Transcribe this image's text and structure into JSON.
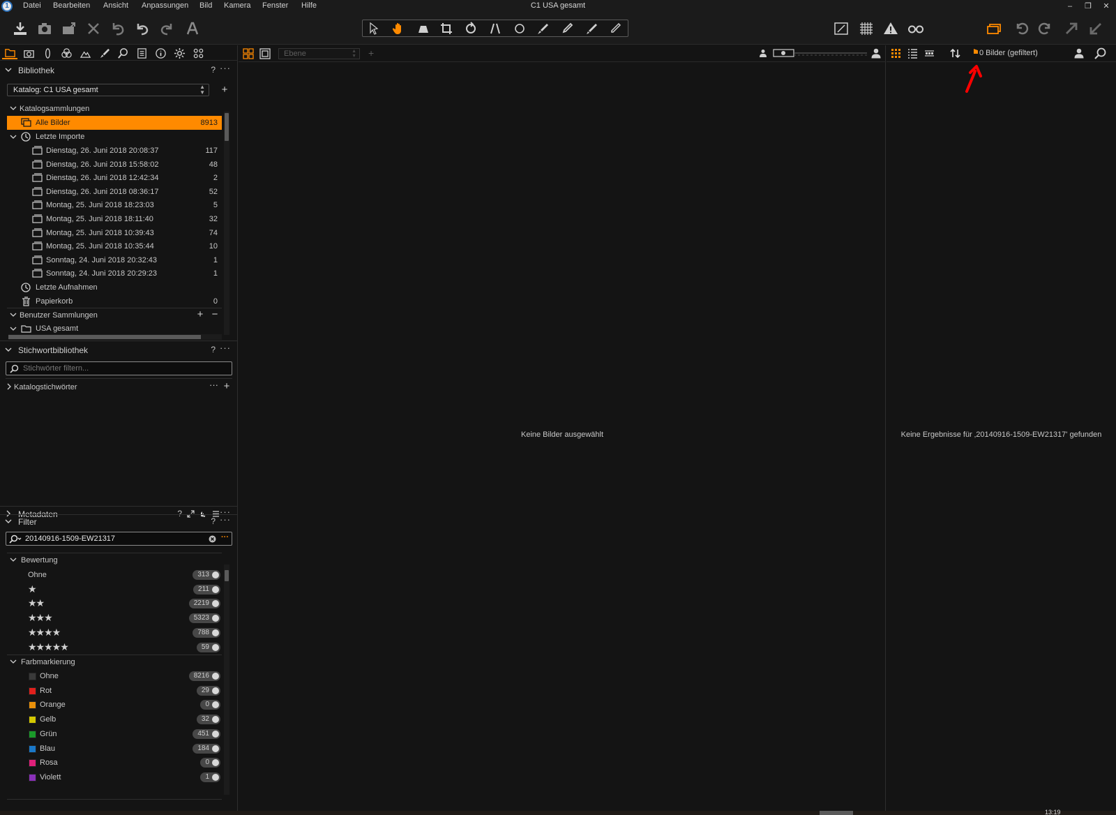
{
  "window": {
    "title": "C1 USA gesamt",
    "minimize": "–",
    "maximize": "❐",
    "close": "✕"
  },
  "menu": [
    "Datei",
    "Bearbeiten",
    "Ansicht",
    "Anpassungen",
    "Bild",
    "Kamera",
    "Fenster",
    "Hilfe"
  ],
  "colors": {
    "accent": "#ff8a00",
    "annotation_arrow": "#ff0000",
    "background": "#141414"
  },
  "library": {
    "title": "Bibliothek",
    "help": "?",
    "more": "···",
    "catalog_select": "Katalog: C1 USA gesamt",
    "catalog_collections": "Katalogsammlungen",
    "all_images": {
      "label": "Alle Bilder",
      "count": "8913"
    },
    "recent_imports": {
      "label": "Letzte Importe",
      "items": [
        {
          "label": "Dienstag, 26. Juni 2018 20:08:37",
          "count": "117"
        },
        {
          "label": "Dienstag, 26. Juni 2018 15:58:02",
          "count": "48"
        },
        {
          "label": "Dienstag, 26. Juni 2018 12:42:34",
          "count": "2"
        },
        {
          "label": "Dienstag, 26. Juni 2018 08:36:17",
          "count": "52"
        },
        {
          "label": "Montag, 25. Juni 2018 18:23:03",
          "count": "5"
        },
        {
          "label": "Montag, 25. Juni 2018 18:11:40",
          "count": "32"
        },
        {
          "label": "Montag, 25. Juni 2018 10:39:43",
          "count": "74"
        },
        {
          "label": "Montag, 25. Juni 2018 10:35:44",
          "count": "10"
        },
        {
          "label": "Sonntag, 24. Juni 2018 20:32:43",
          "count": "1"
        },
        {
          "label": "Sonntag, 24. Juni 2018 20:29:23",
          "count": "1"
        }
      ]
    },
    "recent_captures": "Letzte Aufnahmen",
    "trash": {
      "label": "Papierkorb",
      "count": "0"
    },
    "user_collections": "Benutzer Sammlungen",
    "usa_folder": "USA gesamt"
  },
  "keywords": {
    "title": "Stichwortbibliothek",
    "help": "?",
    "more": "···",
    "filter_placeholder": "Stichwörter filtern...",
    "catalog_keywords": "Katalogstichwörter"
  },
  "metadata": {
    "title": "Metadaten",
    "help": "?",
    "more": "···"
  },
  "filter": {
    "title": "Filter",
    "help": "?",
    "more": "···",
    "search_value": "20140916-1509-EW21317",
    "rating": {
      "title": "Bewertung",
      "items": [
        {
          "label": "Ohne",
          "stars": "",
          "count": "313"
        },
        {
          "label": "",
          "stars": "★",
          "count": "211"
        },
        {
          "label": "",
          "stars": "★★",
          "count": "2219"
        },
        {
          "label": "",
          "stars": "★★★",
          "count": "5323"
        },
        {
          "label": "",
          "stars": "★★★★",
          "count": "788"
        },
        {
          "label": "",
          "stars": "★★★★★",
          "count": "59"
        }
      ]
    },
    "color_tags": {
      "title": "Farbmarkierung",
      "items": [
        {
          "label": "Ohne",
          "color": "#3a3a3a",
          "count": "8216"
        },
        {
          "label": "Rot",
          "color": "#e0201c",
          "count": "29"
        },
        {
          "label": "Orange",
          "color": "#e8900a",
          "count": "0"
        },
        {
          "label": "Gelb",
          "color": "#d4c800",
          "count": "32"
        },
        {
          "label": "Grün",
          "color": "#1a9a2a",
          "count": "451"
        },
        {
          "label": "Blau",
          "color": "#1a78c8",
          "count": "184"
        },
        {
          "label": "Rosa",
          "color": "#e0207a",
          "count": "0"
        },
        {
          "label": "Violett",
          "color": "#8a30b8",
          "count": "1"
        }
      ]
    }
  },
  "viewer": {
    "layer_placeholder": "Ebene",
    "empty_message": "Keine Bilder ausgewählt"
  },
  "browser": {
    "count_label": "0 Bilder (gefiltert)",
    "empty_message": "Keine Ergebnisse für ‚20140916-1509-EW21317' gefunden"
  },
  "statusbar": {
    "clock": "13:19"
  }
}
